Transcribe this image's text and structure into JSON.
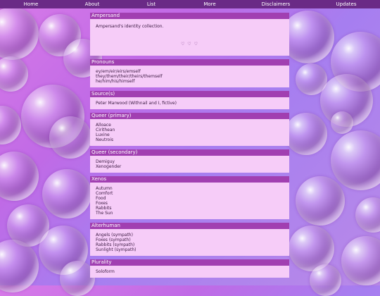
{
  "nav": {
    "items": [
      {
        "label": "Home"
      },
      {
        "label": "About"
      },
      {
        "label": "List"
      },
      {
        "label": "More"
      },
      {
        "label": "Disclaimers"
      },
      {
        "label": "Updates"
      }
    ]
  },
  "sections": {
    "ampersand": {
      "title": "Ampersand",
      "description": "Ampersand's identity collection.",
      "hearts": "♡ ♡ ♡"
    },
    "pronouns": {
      "title": "Pronouns",
      "lines": [
        "ey/em/eir/eirs/emself",
        "they/them/their/theirs/themself",
        "he/him/his/himself"
      ]
    },
    "sources": {
      "title": "Source(s)",
      "lines": [
        "Peter Marwood (Withnail and I, fictive)"
      ]
    },
    "queer_primary": {
      "title": "Queer (primary)",
      "lines": [
        "Alloace",
        "Cirithean",
        "Luxine",
        "Neutrois"
      ]
    },
    "queer_secondary": {
      "title": "Queer (secondary)",
      "lines": [
        "Demiguy",
        "Xenogender"
      ]
    },
    "xenos": {
      "title": "Xenos",
      "lines": [
        "Autumn",
        "Comfort",
        "Food",
        "Foxes",
        "Rabbits",
        "The Sun"
      ]
    },
    "alterhuman": {
      "title": "Alterhuman",
      "lines": [
        "Angels (sympath)",
        "Foxes (sympath)",
        "Rabbits (sympath)",
        "Sunlight (sympath)"
      ]
    },
    "plurality": {
      "title": "Plurality",
      "lines": [
        "Soloform"
      ]
    }
  }
}
